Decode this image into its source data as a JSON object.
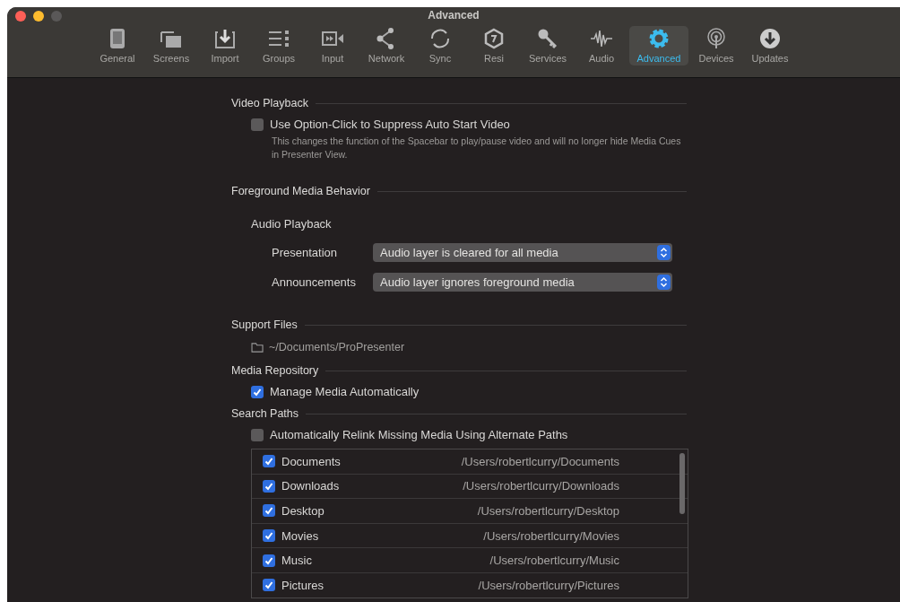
{
  "window": {
    "title": "Advanced"
  },
  "toolbar": [
    {
      "label": "General",
      "selected": false
    },
    {
      "label": "Screens",
      "selected": false
    },
    {
      "label": "Import",
      "selected": false
    },
    {
      "label": "Groups",
      "selected": false
    },
    {
      "label": "Input",
      "selected": false
    },
    {
      "label": "Network",
      "selected": false
    },
    {
      "label": "Sync",
      "selected": false
    },
    {
      "label": "Resi",
      "selected": false
    },
    {
      "label": "Services",
      "selected": false
    },
    {
      "label": "Audio",
      "selected": false
    },
    {
      "label": "Advanced",
      "selected": true
    },
    {
      "label": "Devices",
      "selected": false
    },
    {
      "label": "Updates",
      "selected": false
    }
  ],
  "video_playback": {
    "heading": "Video Playback",
    "option": {
      "label": "Use Option-Click to Suppress Auto Start Video",
      "checked": false,
      "description": "This changes the function of the Spacebar to play/pause video and will no longer hide Media Cues in Presenter View."
    }
  },
  "foreground_media": {
    "heading": "Foreground Media Behavior",
    "subheading": "Audio Playback",
    "rows": [
      {
        "label": "Presentation",
        "value": "Audio layer is cleared for all media"
      },
      {
        "label": "Announcements",
        "value": "Audio layer ignores foreground media"
      }
    ]
  },
  "support_files": {
    "heading": "Support Files",
    "path": "~/Documents/ProPresenter"
  },
  "media_repository": {
    "heading": "Media Repository",
    "option": {
      "label": "Manage Media Automatically",
      "checked": true
    }
  },
  "search_paths": {
    "heading": "Search Paths",
    "option": {
      "label": "Automatically Relink Missing Media Using Alternate Paths",
      "checked": false
    },
    "paths": [
      {
        "name": "Documents",
        "path": "/Users/robertlcurry/Documents",
        "checked": true
      },
      {
        "name": "Downloads",
        "path": "/Users/robertlcurry/Downloads",
        "checked": true
      },
      {
        "name": "Desktop",
        "path": "/Users/robertlcurry/Desktop",
        "checked": true
      },
      {
        "name": "Movies",
        "path": "/Users/robertlcurry/Movies",
        "checked": true
      },
      {
        "name": "Music",
        "path": "/Users/robertlcurry/Music",
        "checked": true
      },
      {
        "name": "Pictures",
        "path": "/Users/robertlcurry/Pictures",
        "checked": true
      }
    ]
  }
}
